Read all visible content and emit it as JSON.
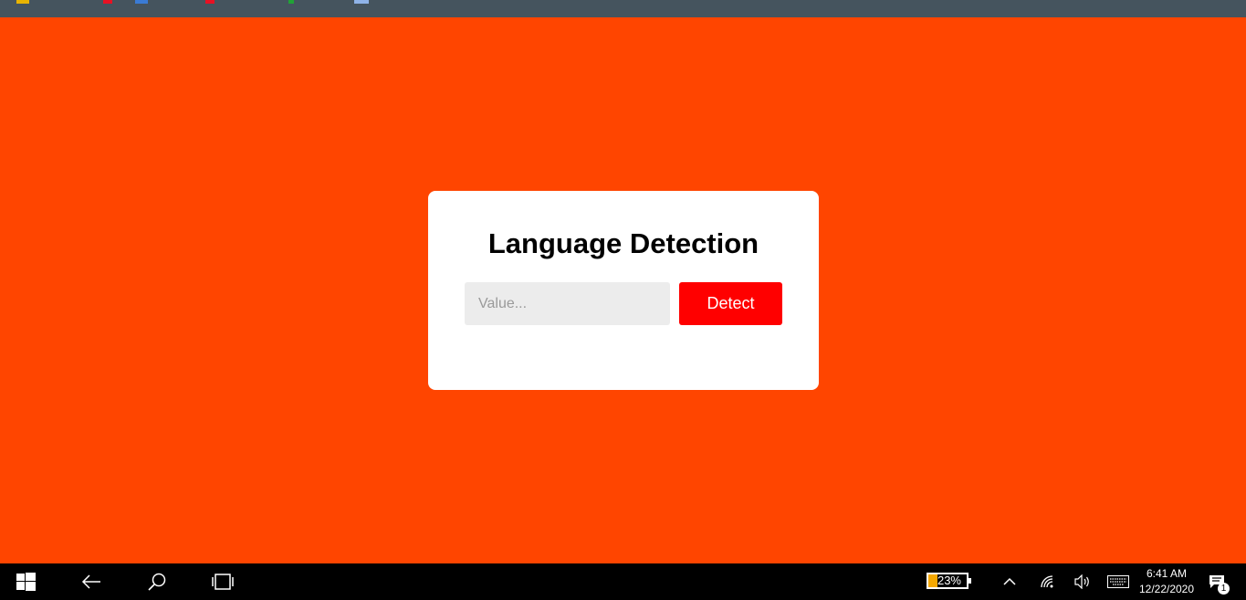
{
  "page": {
    "background_color": "#ff4500"
  },
  "card": {
    "title": "Language Detection",
    "input": {
      "placeholder": "Value...",
      "value": ""
    },
    "detect_button_label": "Detect",
    "button_color": "#ff0000"
  },
  "taskbar": {
    "icons": [
      "windows-start-icon",
      "back-arrow-icon",
      "search-icon",
      "task-view-icon",
      "chevron-up-icon",
      "wifi-icon",
      "volume-icon",
      "keyboard-icon",
      "notification-icon"
    ],
    "battery": {
      "percent_label": "23%",
      "level": 0.23
    },
    "clock": {
      "time": "6:41 AM",
      "date": "12/22/2020"
    },
    "notification_count": "1"
  }
}
